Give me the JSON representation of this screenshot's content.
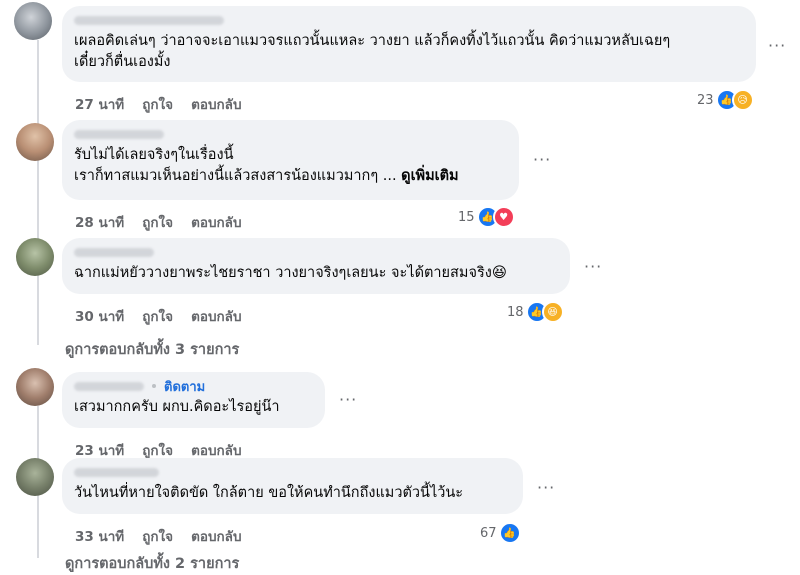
{
  "comments": [
    {
      "text_lines": [
        "เผลอคิดเล่นๆ ว่าอาจจะเอาแมวจรแถวนั้นแหละ วางยา แล้วก็คงทิ้งไว้แถวนั้น คิดว่าแมวหลับเฉยๆ",
        "เดี๋ยวก็ตื่นเองมั้ง"
      ],
      "time": "27 นาที",
      "like_label": "ถูกใจ",
      "reply_label": "ตอบกลับ",
      "reaction_count": "23",
      "reactions": [
        "like-icon",
        "sad-icon"
      ],
      "more": "···"
    },
    {
      "text_lines": [
        "รับไม่ได้เลยจริงๆในเรื่องนี้",
        "เราก็ทาสแมวเห็นอย่างนี้แล้วสงสารน้องแมวมากๆ ..."
      ],
      "see_more": "ดูเพิ่มเติม",
      "time": "28 นาที",
      "like_label": "ถูกใจ",
      "reply_label": "ตอบกลับ",
      "reaction_count": "15",
      "reactions": [
        "like-icon",
        "love-icon"
      ],
      "more": "···"
    },
    {
      "text_lines": [
        "ฉากแม่หยัววางยาพระไชยราชา วางยาจริงๆเลยนะ จะได้ตายสมจริง"
      ],
      "emoji": "😆",
      "time": "30 นาที",
      "like_label": "ถูกใจ",
      "reply_label": "ตอบกลับ",
      "reaction_count": "18",
      "reactions": [
        "like-icon",
        "haha-icon"
      ],
      "more": "···",
      "view_replies": "ดูการตอบกลับทั้ง 3 รายการ"
    },
    {
      "follow": "ติดตาม",
      "text_lines": [
        "เสวมากกครับ ผกบ.คิดอะไรอยู่น๊า"
      ],
      "time": "23 นาที",
      "like_label": "ถูกใจ",
      "reply_label": "ตอบกลับ",
      "more": "···"
    },
    {
      "text_lines": [
        "วันไหนที่หายใจติดขัด ใกล้ตาย ขอให้คนทำนึกถึงแมวตัวนี้ไว้นะ"
      ],
      "time": "33 นาที",
      "like_label": "ถูกใจ",
      "reply_label": "ตอบกลับ",
      "reaction_count": "67",
      "reactions": [
        "like-icon"
      ],
      "more": "···",
      "view_replies": "ดูการตอบกลับทั้ง 2 รายการ"
    }
  ],
  "colors": {
    "bubble": "#f0f2f5",
    "meta": "#65676b",
    "like": "#1877f2",
    "love": "#f33e58",
    "haha": "#f7b125",
    "follow": "#216fdb"
  }
}
